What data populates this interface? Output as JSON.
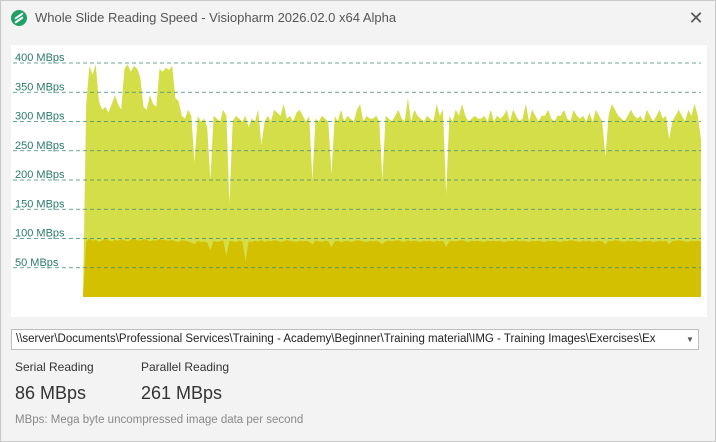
{
  "window": {
    "title": "Whole Slide Reading Speed - Visiopharm 2026.02.0 x64 Alpha",
    "close_glyph": "✕",
    "app_icon": "visiopharm-logo-icon"
  },
  "colors": {
    "parallel_series": "#d4de48",
    "serial_series": "#d3c000",
    "gridline": "#3a8a7a",
    "tick_label": "#2a7a6a",
    "window_bg": "#f3f3f3"
  },
  "chart_data": {
    "type": "area",
    "ylim": [
      0,
      420
    ],
    "y_ticks": [
      {
        "value": 50,
        "label": "50 MBps"
      },
      {
        "value": 100,
        "label": "100 MBps"
      },
      {
        "value": 150,
        "label": "150 MBps"
      },
      {
        "value": 200,
        "label": "200 MBps"
      },
      {
        "value": 250,
        "label": "250 MBps"
      },
      {
        "value": 300,
        "label": "300 MBps"
      },
      {
        "value": 350,
        "label": "350 MBps"
      },
      {
        "value": 400,
        "label": "400 MBps"
      }
    ],
    "grid": true,
    "series": [
      {
        "key": "parallel",
        "values": [
          0,
          330,
          395,
          380,
          398,
          335,
          320,
          325,
          315,
          330,
          345,
          330,
          320,
          390,
          398,
          385,
          395,
          390,
          375,
          325,
          320,
          345,
          330,
          325,
          390,
          385,
          392,
          388,
          395,
          340,
          335,
          310,
          305,
          320,
          310,
          230,
          310,
          300,
          305,
          290,
          200,
          310,
          305,
          300,
          320,
          310,
          160,
          300,
          310,
          305,
          300,
          310,
          290,
          305,
          300,
          320,
          260,
          300,
          310,
          300,
          320,
          315,
          310,
          330,
          305,
          310,
          300,
          315,
          320,
          310,
          300,
          310,
          200,
          305,
          300,
          310,
          305,
          300,
          210,
          310,
          300,
          320,
          300,
          310,
          305,
          300,
          320,
          330,
          300,
          310,
          305,
          305,
          310,
          300,
          200,
          310,
          305,
          300,
          310,
          320,
          305,
          300,
          340,
          300,
          320,
          310,
          305,
          300,
          310,
          305,
          300,
          330,
          310,
          320,
          175,
          310,
          300,
          320,
          310,
          330,
          310,
          300,
          305,
          310,
          305,
          305,
          310,
          300,
          320,
          300,
          310,
          305,
          310,
          320,
          300,
          320,
          310,
          300,
          305,
          330,
          300,
          320,
          310,
          300,
          310,
          310,
          320,
          305,
          300,
          310,
          310,
          320,
          305,
          300,
          320,
          310,
          305,
          310,
          300,
          315,
          300,
          320,
          310,
          300,
          240,
          310,
          330,
          320,
          310,
          305,
          300,
          310,
          320,
          310,
          305,
          310,
          300,
          320,
          310,
          300,
          310,
          320,
          305,
          310,
          270,
          300,
          310,
          320,
          310,
          300,
          320,
          310,
          330,
          310,
          270
        ],
        "values_note": ""
      },
      {
        "key": "serial",
        "values": [
          0,
          95,
          100,
          96,
          98,
          94,
          96,
          100,
          97,
          95,
          98,
          96,
          99,
          97,
          95,
          98,
          100,
          97,
          96,
          99,
          98,
          95,
          97,
          96,
          99,
          98,
          97,
          96,
          98,
          95,
          94,
          97,
          96,
          95,
          93,
          90,
          96,
          94,
          95,
          93,
          80,
          96,
          94,
          95,
          97,
          70,
          96,
          95,
          94,
          96,
          95,
          60,
          95,
          94,
          96,
          95,
          97,
          94,
          96,
          95,
          97,
          96,
          94,
          95,
          97,
          96,
          95,
          94,
          96,
          95,
          96,
          94,
          90,
          96,
          95,
          94,
          96,
          95,
          85,
          95,
          96,
          94,
          95,
          96,
          94,
          95,
          97,
          96,
          95,
          94,
          96,
          95,
          96,
          94,
          90,
          95,
          96,
          95,
          96,
          97,
          95,
          94,
          97,
          95,
          96,
          95,
          94,
          96,
          95,
          96,
          94,
          96,
          95,
          96,
          85,
          95,
          96,
          95,
          96,
          97,
          95,
          94,
          96,
          95,
          96,
          95,
          94,
          96,
          95,
          96,
          95,
          96,
          94,
          95,
          96,
          95,
          97,
          95,
          96,
          95,
          94,
          96,
          95,
          96,
          95,
          94,
          96,
          95,
          96,
          95,
          94,
          96,
          95,
          97,
          96,
          95,
          94,
          96,
          95,
          96,
          94,
          95,
          96,
          95,
          90,
          96,
          95,
          97,
          96,
          95,
          94,
          96,
          95,
          96,
          95,
          94,
          96,
          95,
          96,
          94,
          95,
          96,
          95,
          96,
          90,
          95,
          96,
          97,
          96,
          95,
          94,
          96,
          95,
          96,
          95
        ]
      }
    ]
  },
  "path_field": {
    "value": "\\\\server\\Documents\\Professional Services\\Training - Academy\\Beginner\\Training material\\IMG - Training Images\\Exercises\\Ex",
    "dropdown_icon": "chevron-down-icon",
    "dropdown_glyph": "▼"
  },
  "stats": {
    "serial_label": "Serial Reading",
    "serial_value": "86 MBps",
    "parallel_label": "Parallel Reading",
    "parallel_value": "261 MBps"
  },
  "footnote": "MBps: Mega byte uncompressed image data per second"
}
